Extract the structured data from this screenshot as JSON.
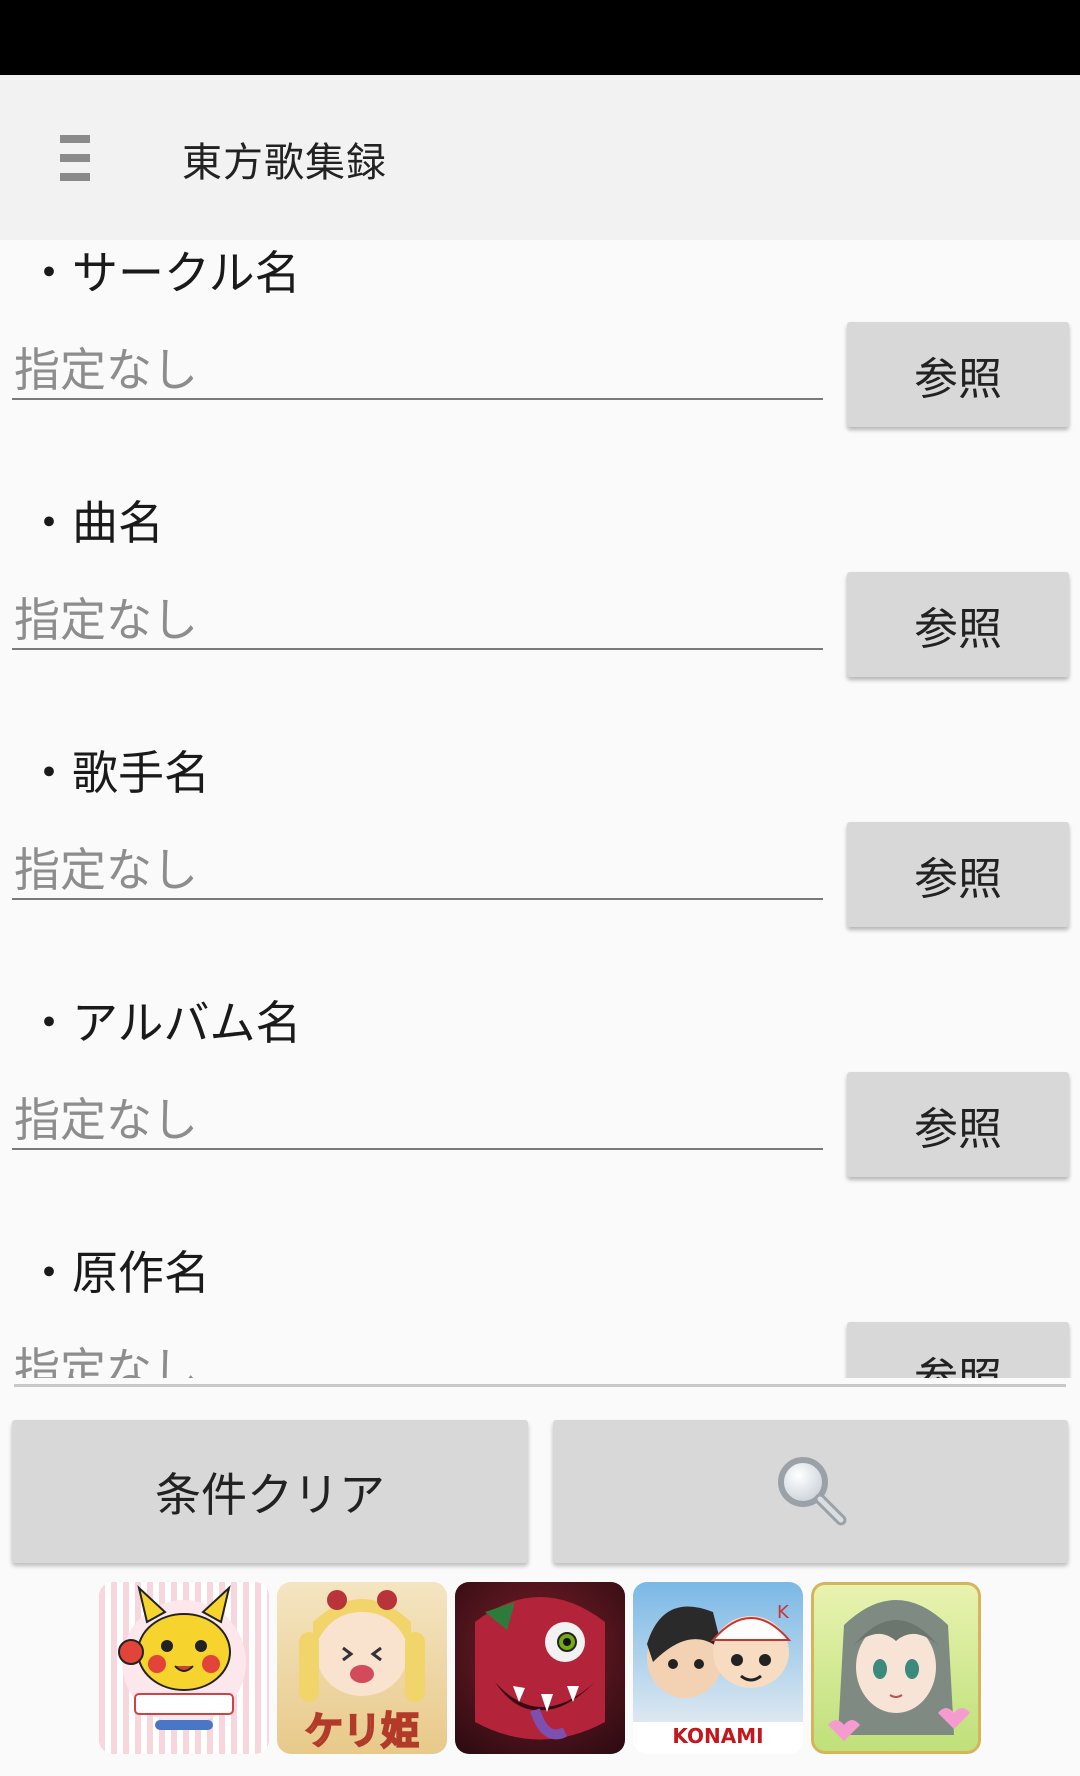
{
  "app_bar": {
    "title": "東方歌集録",
    "menu_icon": "hamburger-menu-icon"
  },
  "sections": [
    {
      "label": "・サークル名",
      "field_value": "指定なし",
      "button": "参照"
    },
    {
      "label": "・曲名",
      "field_value": "指定なし",
      "button": "参照"
    },
    {
      "label": "・歌手名",
      "field_value": "指定なし",
      "button": "参照"
    },
    {
      "label": "・アルバム名",
      "field_value": "指定なし",
      "button": "参照"
    },
    {
      "label": "・原作名",
      "field_value": "指定なし",
      "button": "参照"
    }
  ],
  "actions": {
    "clear_label": "条件クリア",
    "search_icon": "search-icon"
  },
  "ads": [
    {
      "name": "pikachu-app-icon",
      "text": ""
    },
    {
      "name": "keri-hime-app-icon",
      "text": "ケリ姫"
    },
    {
      "name": "monster-app-icon",
      "text": ""
    },
    {
      "name": "konami-app-icon",
      "text": "KONAMI"
    },
    {
      "name": "anime-girl-app-icon",
      "text": ""
    }
  ],
  "colors": {
    "status_bar": "#000000",
    "app_bar": "#f2f2f2",
    "button": "#d8d8d8",
    "hint_text": "#8d8d8d"
  }
}
